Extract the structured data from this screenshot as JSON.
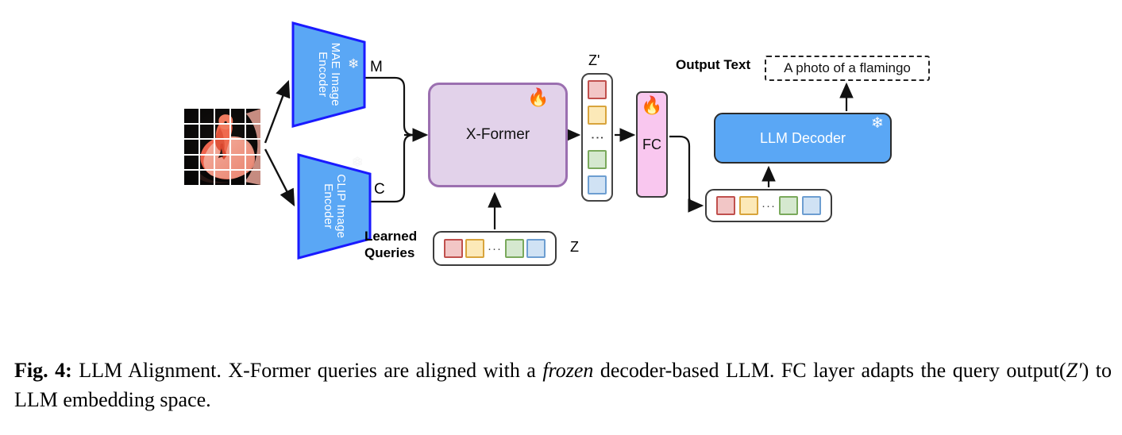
{
  "figure": {
    "input_image": {
      "name": "flamingo-patch-grid",
      "alt": "Flamingo photo divided into 5 by 5 patches",
      "grid_rows": 5,
      "grid_cols": 5
    },
    "encoders": [
      {
        "id": "mae",
        "label": "MAE Image\nEncoder",
        "line1": "MAE Image",
        "line2": "Encoder",
        "status_icon": "snowflake-icon",
        "status": "frozen",
        "fill": "#5aa7f5",
        "stroke": "#1a1aff",
        "output_label": "M"
      },
      {
        "id": "clip",
        "label": "CLIP Image\nEncoder",
        "line1": "CLIP Image",
        "line2": "Encoder",
        "status_icon": "snowflake-icon",
        "status": "frozen",
        "fill": "#5aa7f5",
        "stroke": "#1a1aff",
        "output_label": "C"
      }
    ],
    "xformer": {
      "label": "X-Former",
      "status_icon": "flame-icon",
      "status": "trainable",
      "fill": "#e2d2ea",
      "stroke": "#9b6fb0"
    },
    "zprime": {
      "label": "Z'",
      "tokens": [
        "red",
        "yellow",
        "ellipsis",
        "green",
        "blue"
      ],
      "ellipsis": "⋮"
    },
    "fc": {
      "label": "FC",
      "status_icon": "flame-icon",
      "status": "trainable",
      "fill": "#f9c7ef",
      "stroke": "#3b3b3b"
    },
    "learned_queries": {
      "label_line1": "Learned",
      "label_line2": "Queries",
      "box_label": "Z",
      "tokens": [
        "red",
        "yellow",
        "ellipsis",
        "green",
        "blue"
      ],
      "ellipsis": "···"
    },
    "embedding_row": {
      "tokens": [
        "red",
        "yellow",
        "ellipsis",
        "green",
        "blue"
      ],
      "ellipsis": "···"
    },
    "llm_decoder": {
      "label": "LLM Decoder",
      "status_icon": "snowflake-icon",
      "status": "frozen",
      "fill": "#5aa7f5",
      "stroke": "#2b2b2b"
    },
    "output": {
      "label": "Output Text",
      "value": "A photo of a flamingo"
    },
    "icons": {
      "flame": "🔥",
      "snowflake": "❄"
    },
    "token_colors": {
      "red": "#f2c6c6",
      "red_border": "#c0504d",
      "yellow": "#fce9b8",
      "yellow_border": "#d8a43c",
      "green": "#d5e8cf",
      "green_border": "#7aa95c",
      "blue": "#d0e2f4",
      "blue_border": "#6d9ed1"
    }
  },
  "caption": {
    "number": "Fig. 4:",
    "text_1": " LLM Alignment. X-Former queries are aligned with a ",
    "italic_1": "frozen",
    "text_2": " decoder-based LLM. FC layer adapts the query output(",
    "math_1": "Z",
    "math_prime": "′",
    "text_3": ") to LLM embedding space."
  }
}
